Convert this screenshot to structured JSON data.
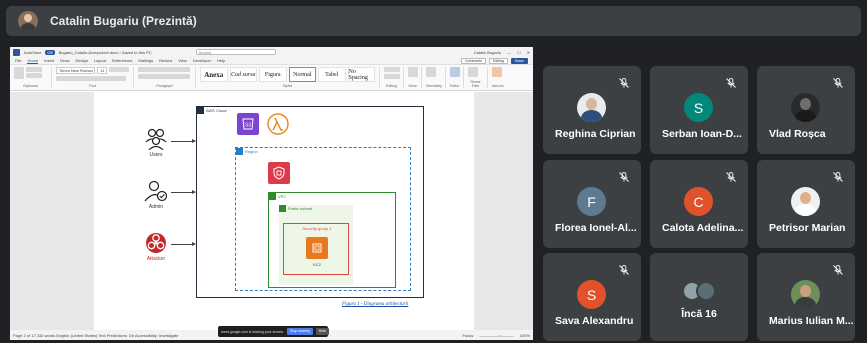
{
  "presenter": {
    "name": "Catalin Bugariu (Prezintă)"
  },
  "word": {
    "autosave": "AutoSave",
    "autosave_state": "Off",
    "doc_title": "Bugariu_Catalin-Acreproiect.docx • Saved to this PC",
    "search_placeholder": "Search",
    "user": "Catalin Bugariu",
    "menu": [
      "File",
      "Home",
      "Insert",
      "Draw",
      "Design",
      "Layout",
      "References",
      "Mailings",
      "Review",
      "View",
      "Developer",
      "Help"
    ],
    "menu_active": "Home",
    "comments": "Comments",
    "editing": "Editing",
    "share": "Share",
    "font_name": "Times New Roman",
    "font_size": "11",
    "ribbon_groups": [
      "Clipboard",
      "Font",
      "Paragraph",
      "Styles",
      "Editing",
      "Voice",
      "Sensitivity",
      "Editor",
      "Reuse Files",
      "Add-ins"
    ],
    "styles": [
      {
        "label": "Anexa",
        "kind": "bold"
      },
      {
        "label": "Cod sursa",
        "kind": "it"
      },
      {
        "label": "Figura",
        "kind": "normal"
      },
      {
        "label": "Normal",
        "kind": "sel"
      },
      {
        "label": "Tabel",
        "kind": "normal"
      },
      {
        "label": "No Spacing",
        "kind": "normal"
      }
    ],
    "status_left": "Page 2 of 17   330 words   English (United States)   Text Predictions: On   Accessibility: Investigate",
    "status_right": "Focus",
    "zoom": "100%"
  },
  "diagram": {
    "actors": [
      {
        "label": "Users"
      },
      {
        "label": "Admin"
      },
      {
        "label": "Attacker"
      }
    ],
    "aws_cloud": "AWS Cloud",
    "region": "Region",
    "vpc": "VPC",
    "public_subnet": "Public subnet",
    "security_group": "Security group 1",
    "ec2": "EC2",
    "caption": "Figura 1 - Diagrama arhitecturii"
  },
  "share_banner": {
    "text": "meet.google.com is sharing your screen.",
    "stop": "Stop sharing",
    "hide": "Hide"
  },
  "participants": [
    {
      "name": "Reghina Ciprian",
      "type": "photo",
      "muted": true
    },
    {
      "name": "Serban Ioan-D...",
      "type": "initial",
      "initial": "S",
      "color": "#00897b",
      "muted": true
    },
    {
      "name": "Vlad Roșca",
      "type": "photo-dark",
      "muted": true
    },
    {
      "name": "Florea Ionel-Al...",
      "type": "initial",
      "initial": "F",
      "color": "#5f7a8f",
      "muted": true
    },
    {
      "name": "Calota Adelina...",
      "type": "initial",
      "initial": "C",
      "color": "#e2522a",
      "muted": true
    },
    {
      "name": "Petrisor Marian",
      "type": "photo-light",
      "muted": true
    },
    {
      "name": "Sava Alexandru",
      "type": "initial",
      "initial": "S",
      "color": "#e2522a",
      "muted": true
    },
    {
      "name": "Încă 16",
      "type": "more",
      "muted": false
    },
    {
      "name": "Marius Iulian M...",
      "type": "photo-green",
      "muted": true
    }
  ],
  "colors": {
    "background": "#202124",
    "tile": "#3c4043",
    "word_blue": "#2b579a",
    "aws_orange": "#e87a1d",
    "aws_purple": "#7b44d1",
    "lambda_orange": "#e8861d",
    "attacker_red": "#c62828"
  }
}
